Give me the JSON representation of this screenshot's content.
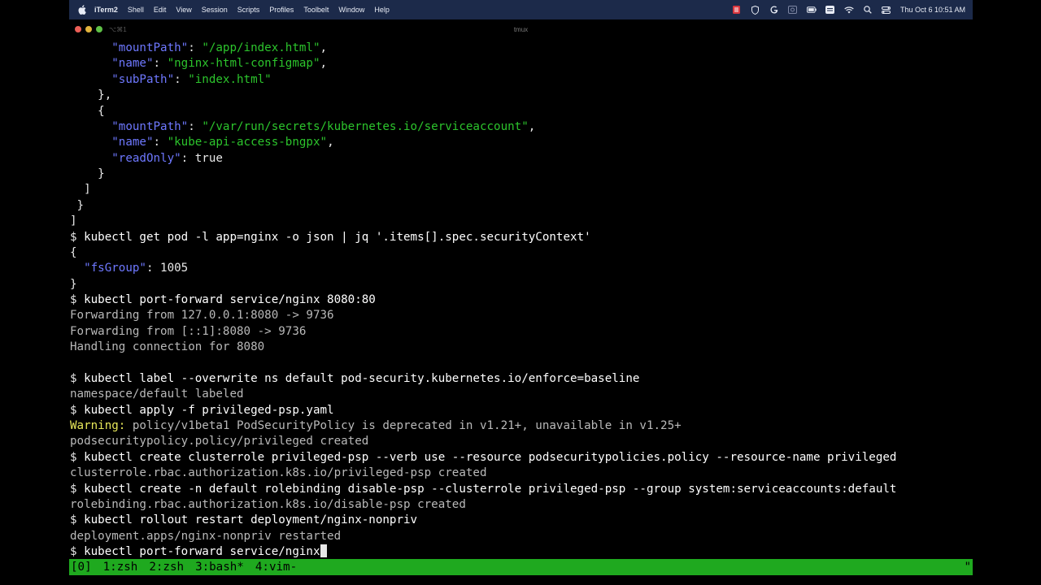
{
  "menubar": {
    "app_name": "iTerm2",
    "menus": [
      "Shell",
      "Edit",
      "View",
      "Session",
      "Scripts",
      "Profiles",
      "Toolbelt",
      "Window",
      "Help"
    ],
    "clock": "Thu Oct 6  10:51 AM",
    "bg_color": "#1c2a4a"
  },
  "window": {
    "shortcut": "⌥⌘1",
    "title": "tmux"
  },
  "colors": {
    "json_key": "#6e78ff",
    "json_string": "#2cc42c",
    "warning": "#e8e85a",
    "tmux_bar": "#1fa91f"
  },
  "terminal": {
    "lines": [
      [
        {
          "t": "      ",
          "c": "pun"
        },
        {
          "t": "\"mountPath\"",
          "c": "key"
        },
        {
          "t": ": ",
          "c": "pun"
        },
        {
          "t": "\"/app/index.html\"",
          "c": "str"
        },
        {
          "t": ",",
          "c": "pun"
        }
      ],
      [
        {
          "t": "      ",
          "c": "pun"
        },
        {
          "t": "\"name\"",
          "c": "key"
        },
        {
          "t": ": ",
          "c": "pun"
        },
        {
          "t": "\"nginx-html-configmap\"",
          "c": "str"
        },
        {
          "t": ",",
          "c": "pun"
        }
      ],
      [
        {
          "t": "      ",
          "c": "pun"
        },
        {
          "t": "\"subPath\"",
          "c": "key"
        },
        {
          "t": ": ",
          "c": "pun"
        },
        {
          "t": "\"index.html\"",
          "c": "str"
        }
      ],
      [
        {
          "t": "    },",
          "c": "pun"
        }
      ],
      [
        {
          "t": "    {",
          "c": "pun"
        }
      ],
      [
        {
          "t": "      ",
          "c": "pun"
        },
        {
          "t": "\"mountPath\"",
          "c": "key"
        },
        {
          "t": ": ",
          "c": "pun"
        },
        {
          "t": "\"/var/run/secrets/kubernetes.io/serviceaccount\"",
          "c": "str"
        },
        {
          "t": ",",
          "c": "pun"
        }
      ],
      [
        {
          "t": "      ",
          "c": "pun"
        },
        {
          "t": "\"name\"",
          "c": "key"
        },
        {
          "t": ": ",
          "c": "pun"
        },
        {
          "t": "\"kube-api-access-bngpx\"",
          "c": "str"
        },
        {
          "t": ",",
          "c": "pun"
        }
      ],
      [
        {
          "t": "      ",
          "c": "pun"
        },
        {
          "t": "\"readOnly\"",
          "c": "key"
        },
        {
          "t": ": true",
          "c": "pun"
        }
      ],
      [
        {
          "t": "    }",
          "c": "pun"
        }
      ],
      [
        {
          "t": "  ]",
          "c": "pun"
        }
      ],
      [
        {
          "t": " }",
          "c": "pun"
        }
      ],
      [
        {
          "t": "]",
          "c": "pun"
        }
      ],
      [
        {
          "t": "$ ",
          "c": "prompt"
        },
        {
          "t": "kubectl get pod -l app=nginx -o json | jq '.items[].spec.securityContext'",
          "c": "cmd"
        }
      ],
      [
        {
          "t": "{",
          "c": "pun"
        }
      ],
      [
        {
          "t": "  ",
          "c": "pun"
        },
        {
          "t": "\"fsGroup\"",
          "c": "key"
        },
        {
          "t": ": 1005",
          "c": "pun"
        }
      ],
      [
        {
          "t": "}",
          "c": "pun"
        }
      ],
      [
        {
          "t": "$ ",
          "c": "prompt"
        },
        {
          "t": "kubectl port-forward service/nginx 8080:80",
          "c": "cmd"
        }
      ],
      [
        {
          "t": "Forwarding from 127.0.0.1:8080 -> 9736",
          "c": "out"
        }
      ],
      [
        {
          "t": "Forwarding from [::1]:8080 -> 9736",
          "c": "out"
        }
      ],
      [
        {
          "t": "Handling connection for 8080",
          "c": "out"
        }
      ],
      [
        {
          "t": "",
          "c": "out"
        }
      ],
      [
        {
          "t": "$ ",
          "c": "prompt"
        },
        {
          "t": "kubectl label --overwrite ns default pod-security.kubernetes.io/enforce=baseline",
          "c": "cmd"
        }
      ],
      [
        {
          "t": "namespace/default labeled",
          "c": "out"
        }
      ],
      [
        {
          "t": "$ ",
          "c": "prompt"
        },
        {
          "t": "kubectl apply -f privileged-psp.yaml",
          "c": "cmd"
        }
      ],
      [
        {
          "t": "Warning:",
          "c": "warn"
        },
        {
          "t": " policy/v1beta1 PodSecurityPolicy is deprecated in v1.21+, unavailable in v1.25+",
          "c": "out"
        }
      ],
      [
        {
          "t": "podsecuritypolicy.policy/privileged created",
          "c": "out"
        }
      ],
      [
        {
          "t": "$ ",
          "c": "prompt"
        },
        {
          "t": "kubectl create clusterrole privileged-psp --verb use --resource podsecuritypolicies.policy --resource-name privileged",
          "c": "cmd"
        }
      ],
      [
        {
          "t": "clusterrole.rbac.authorization.k8s.io/privileged-psp created",
          "c": "out"
        }
      ],
      [
        {
          "t": "$ ",
          "c": "prompt"
        },
        {
          "t": "kubectl create -n default rolebinding disable-psp --clusterrole privileged-psp --group system:serviceaccounts:default",
          "c": "cmd"
        }
      ],
      [
        {
          "t": "rolebinding.rbac.authorization.k8s.io/disable-psp created",
          "c": "out"
        }
      ],
      [
        {
          "t": "$ ",
          "c": "prompt"
        },
        {
          "t": "kubectl rollout restart deployment/nginx-nonpriv",
          "c": "cmd"
        }
      ],
      [
        {
          "t": "deployment.apps/nginx-nonpriv restarted",
          "c": "out"
        }
      ],
      [
        {
          "t": "$ ",
          "c": "prompt"
        },
        {
          "t": "kubectl port-forward service/nginx",
          "c": "cmd"
        }
      ]
    ]
  },
  "tmux": {
    "session": "[0]",
    "windows": [
      "1:zsh",
      "2:zsh",
      "3:bash*",
      "4:vim-"
    ],
    "right_text": "\""
  }
}
